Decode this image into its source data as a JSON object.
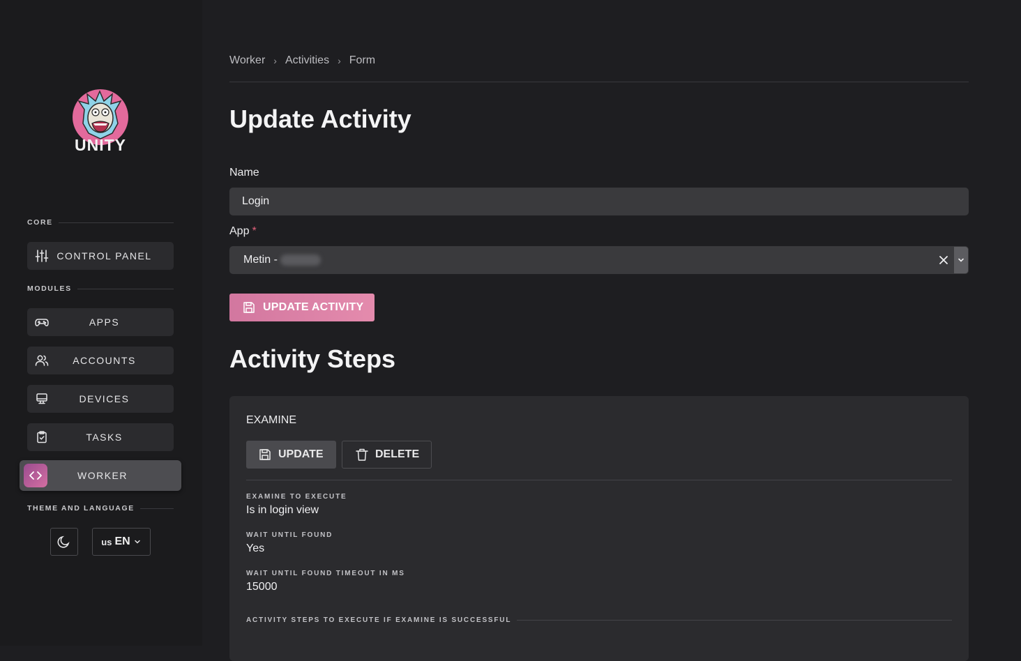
{
  "sidebar": {
    "logo_text": "UNITY",
    "sections": {
      "core": "CORE",
      "modules": "MODULES",
      "theme": "THEME AND LANGUAGE"
    },
    "items": {
      "control_panel": "CONTROL PANEL",
      "apps": "APPS",
      "accounts": "ACCOUNTS",
      "devices": "DEVICES",
      "tasks": "TASKS",
      "worker": "WORKER"
    },
    "language": {
      "flag": "us",
      "code": "EN"
    }
  },
  "breadcrumb": [
    "Worker",
    "Activities",
    "Form"
  ],
  "page_title": "Update Activity",
  "form": {
    "name_label": "Name",
    "name_value": "Login",
    "app_label": "App",
    "app_required": "*",
    "app_value": "Metin -",
    "submit_label": "UPDATE ACTIVITY"
  },
  "steps": {
    "title": "Activity Steps",
    "card": {
      "title": "EXAMINE",
      "update_label": "UPDATE",
      "delete_label": "DELETE",
      "examine_label": "EXAMINE TO EXECUTE",
      "examine_value": "Is in login view",
      "wait_label": "WAIT UNTIL FOUND",
      "wait_value": "Yes",
      "timeout_label": "WAIT UNTIL FOUND TIMEOUT IN MS",
      "timeout_value": "15000",
      "success_section": "ACTIVITY STEPS TO EXECUTE IF EXAMINE IS SUCCESSFUL"
    }
  },
  "colors": {
    "background": "#1e1e21",
    "accent": "#e48bad",
    "surface": "#2b2b2e"
  }
}
